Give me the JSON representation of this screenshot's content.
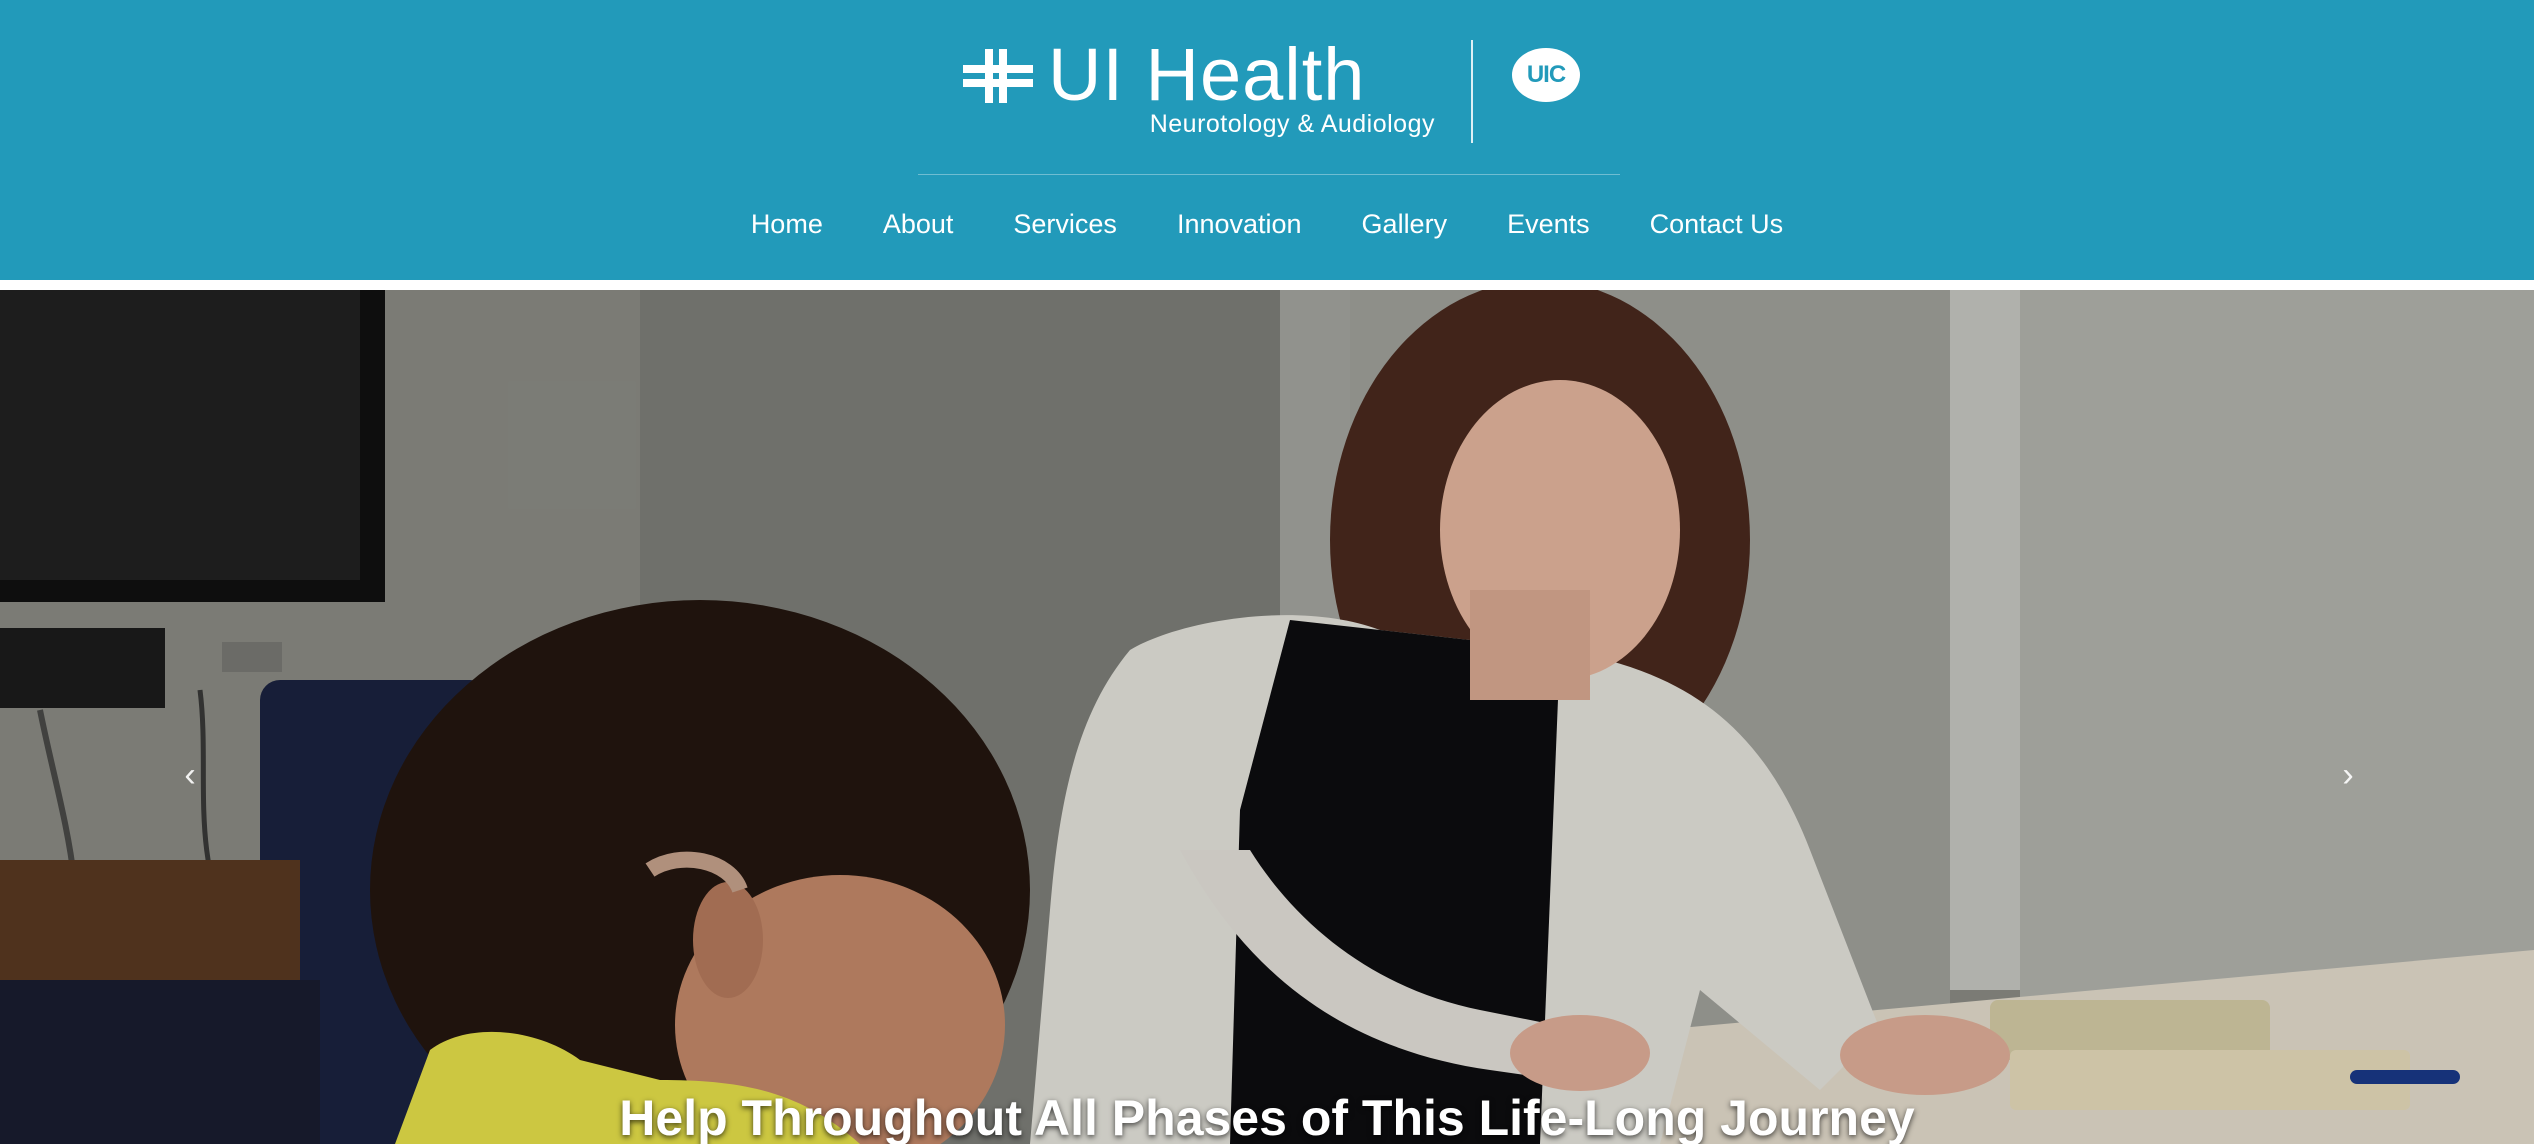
{
  "header": {
    "brand_name": "UI Health",
    "brand_subtitle": "Neurotology & Audiology",
    "partner_badge": "UIC",
    "logo_icon": "cross-logo-icon",
    "background_color": "#229aba"
  },
  "nav": {
    "items": [
      {
        "label": "Home"
      },
      {
        "label": "About"
      },
      {
        "label": "Services"
      },
      {
        "label": "Innovation"
      },
      {
        "label": "Gallery"
      },
      {
        "label": "Events"
      },
      {
        "label": "Contact Us"
      }
    ]
  },
  "hero": {
    "caption": "Help Throughout All Phases of This Life-Long Journey",
    "prev_arrow": "‹",
    "next_arrow": "›",
    "prev_icon": "chevron-left-icon",
    "next_icon": "chevron-right-icon"
  }
}
